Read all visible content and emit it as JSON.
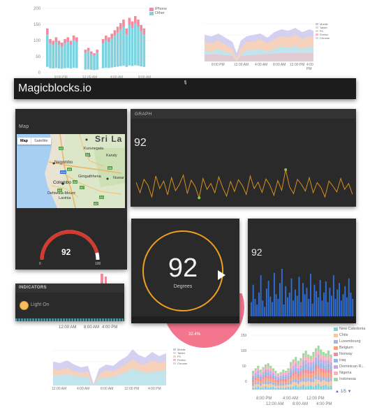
{
  "app": {
    "title": "Magicblocks.io"
  },
  "bg_charts": {
    "top_left": {
      "y_ticks": [
        "200",
        "150",
        "100",
        "50",
        "0"
      ],
      "x_ticks": [
        "8:00 PM",
        "12:00 AM",
        "4:00 AM",
        "8:00 AM"
      ],
      "legend": [
        "iPhone",
        "Other"
      ],
      "legend_colors": [
        "#f48aa0",
        "#7fd3e0"
      ]
    },
    "top_right": {
      "x_ticks": [
        "8:00 PM",
        "12:00 AM",
        "4:00 AM",
        "8:00 AM",
        "12:00 PM",
        "4:00 PM"
      ],
      "legend": [
        "Mobile",
        "Tablet",
        "PC",
        "Firefox",
        "Chrome"
      ]
    },
    "bottom_left": {
      "x_ticks": [
        "12:00 AM",
        "4:00 AM",
        "8:00 AM",
        "12:00 PM",
        "4:00 PM"
      ],
      "x_ticks_row2": [
        "12:00 AM",
        "8:00 AM",
        "4:00 PM"
      ],
      "legend": [
        "Mobile",
        "Tablet",
        "PC",
        "Firefox",
        "Chrome"
      ]
    },
    "bottom_right": {
      "y_ticks": [
        "150",
        "100",
        "50",
        "0"
      ],
      "x_ticks": [
        "8:00 PM",
        "4:00 AM",
        "12:00 PM",
        "8:00 PM"
      ],
      "x_ticks_row2": [
        "12:00 AM",
        "8:00 AM",
        "4:00 PM"
      ],
      "legend": [
        "New Caledonia",
        "Chile",
        "Luxembourg",
        "Belgium",
        "Norway",
        "Iraq",
        "Dominican R...",
        "Nigeria",
        "Indonesia"
      ],
      "legend_colors": [
        "#7fd3e0",
        "#f7c59f",
        "#a7b4e0",
        "#f4a27a",
        "#f48aa0",
        "#8fb8e8",
        "#c6a7e0",
        "#f7b0c0",
        "#a0d8a0"
      ],
      "pager": "1/5"
    },
    "pie_label": "32.4%"
  },
  "map_panel": {
    "title": "Map",
    "toggle_map": "Map",
    "toggle_satellite": "Satellite",
    "places": {
      "country": "Sri La",
      "kurunegala": "Kurunegala",
      "kandy": "Kandy",
      "negombo": "Negombo",
      "colombo": "Colombo",
      "ginigathhena": "Ginigathhena",
      "nuwara": "Nuwar",
      "dehiwala": "Dehiwala-Mount",
      "lavinia": "Lavinia"
    },
    "roads": [
      "A3",
      "A1",
      "A6",
      "A1",
      "E03",
      "A4",
      "A7",
      "A2",
      "A4",
      "A2"
    ]
  },
  "gauge_panel": {
    "value": "92",
    "min": "0",
    "max": "100",
    "level": 0.92
  },
  "indicators_panel": {
    "title": "INDICATORS",
    "light_label": "Light On",
    "light_color": "#f6bd60"
  },
  "graph_panel": {
    "title": "GRAPH",
    "value": "92",
    "line_color": "#d4901e",
    "series": [
      55,
      30,
      62,
      48,
      20,
      70,
      40,
      58,
      25,
      66,
      35,
      50,
      72,
      28,
      60,
      45,
      18,
      64,
      38,
      52,
      30,
      68,
      42,
      22,
      57,
      33,
      61,
      47,
      26,
      70,
      40,
      55,
      31,
      63,
      48,
      24,
      59,
      36,
      85,
      44,
      28,
      62,
      50,
      34,
      66,
      30,
      54,
      42,
      20,
      58,
      46,
      32,
      64,
      38,
      52,
      26
    ]
  },
  "dial_panel": {
    "value": "92",
    "label": "Degrees",
    "ring_color": "#f0a020"
  },
  "bars_panel": {
    "value": "92",
    "bar_color": "#2f6fd6",
    "values": [
      18,
      40,
      22,
      15,
      30,
      52,
      20,
      12,
      35,
      45,
      25,
      18,
      55,
      28,
      22,
      42,
      60,
      15,
      38,
      24,
      30,
      48,
      20,
      34,
      26,
      50,
      18,
      42,
      28,
      36,
      22,
      54,
      16,
      40,
      32,
      24,
      46,
      20,
      30,
      44,
      18,
      36,
      26,
      52,
      22,
      34,
      42,
      20,
      28,
      38,
      24,
      48,
      30,
      22
    ]
  }
}
